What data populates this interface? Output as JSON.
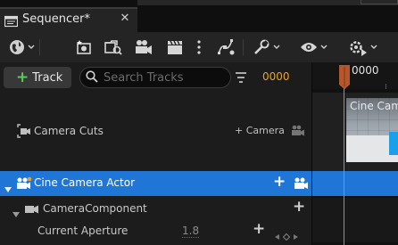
{
  "window": {
    "tab_title": "Sequencer*",
    "close_glyph": "✕"
  },
  "toolbar": {
    "icons": [
      "globe-icon",
      "snapshot-icon",
      "render-movie-icon",
      "camera-icon",
      "clapperboard-icon",
      "more-icon",
      "curve-editor-icon",
      "settings-wrench-icon",
      "view-eye-icon",
      "playback-settings-icon"
    ]
  },
  "subbar": {
    "add_track_plus": "+",
    "add_track_label": "Track",
    "search_placeholder": "Search Tracks",
    "current_frame": "0000"
  },
  "tracks": {
    "camera_cuts": {
      "label": "Camera Cuts",
      "add_camera_label": "+ Camera"
    },
    "cine_camera_actor": {
      "label": "Cine Camera Actor",
      "plus": "+"
    },
    "camera_component": {
      "label": "CameraComponent",
      "plus": "+"
    },
    "current_aperture": {
      "label": "Current Aperture",
      "value": "1.8",
      "plus": "+"
    }
  },
  "timeline": {
    "ruler_frame": "0000",
    "thumbnail_label": "Cine Camera"
  },
  "colors": {
    "selection": "#1f76d7",
    "playhead": "#3ccf3c",
    "playhead_handle": "#b5562c",
    "frame_number": "#f0a020",
    "add_green": "#5cc95c"
  }
}
